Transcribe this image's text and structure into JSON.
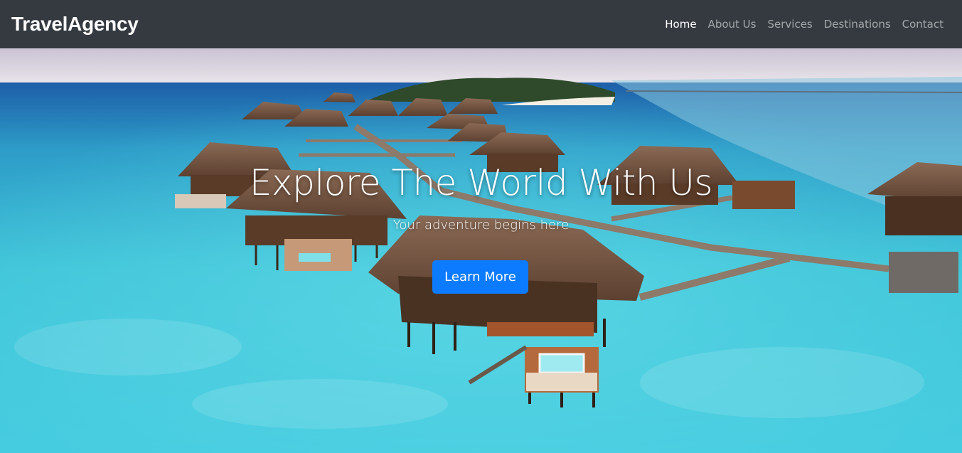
{
  "navbar": {
    "brand": "TravelAgency",
    "links": [
      {
        "label": "Home",
        "active": true
      },
      {
        "label": "About Us",
        "active": false
      },
      {
        "label": "Services",
        "active": false
      },
      {
        "label": "Destinations",
        "active": false
      },
      {
        "label": "Contact",
        "active": false
      }
    ]
  },
  "hero": {
    "title": "Explore The World With Us",
    "subtitle": "Your adventure begins here",
    "button_label": "Learn More",
    "image_subject": "overwater-bungalows-tropical-lagoon"
  },
  "colors": {
    "navbar_bg": "#343a40",
    "button_bg": "#0d7bff",
    "text_white": "#ffffff"
  }
}
